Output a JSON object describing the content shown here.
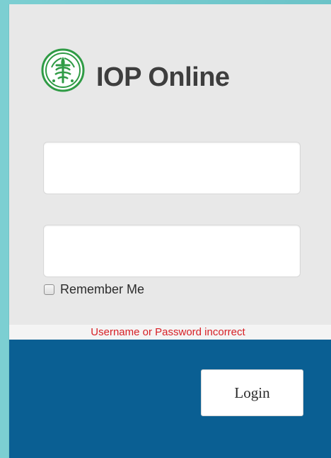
{
  "app": {
    "brand": {
      "title": "IOP Online",
      "logo_icon": "medical-emblem-icon"
    }
  },
  "form": {
    "username": {
      "value": "",
      "placeholder": ""
    },
    "password": {
      "value": "",
      "placeholder": ""
    },
    "remember": {
      "label": "Remember Me",
      "checked": false
    },
    "error": {
      "text": "Username or Password incorrect",
      "color": "#d71f25"
    },
    "login": {
      "label": "Login"
    }
  },
  "colors": {
    "background_teal": "#73c8cb",
    "panel_gray": "#e8e8e8",
    "footer_blue": "#0a5f93",
    "logo_green": "#2f9b45"
  }
}
